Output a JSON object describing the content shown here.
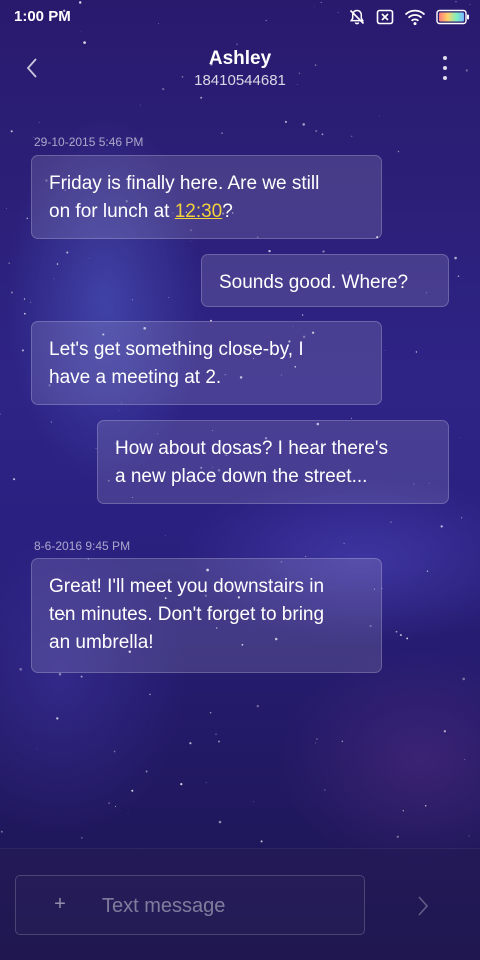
{
  "status_bar": {
    "time": "1:00 PM",
    "icons": [
      "notifications-off-icon",
      "no-sim-icon",
      "wifi-icon",
      "battery-icon"
    ]
  },
  "header": {
    "contact_name": "Ashley",
    "contact_number": "18410544681",
    "back_icon": "chevron-left-icon",
    "menu_icon": "more-vertical-icon"
  },
  "conversation": {
    "timestamp_1": "29-10-2015 5:46 PM",
    "msg_1": {
      "line_1": "Friday is finally here. Are we still",
      "line_2_prefix": "on for lunch at ",
      "link_text": "12:30",
      "line_2_suffix": "?"
    },
    "msg_2": "Sounds good. Where?",
    "msg_3": {
      "line_1": "Let's get something close-by, I",
      "line_2": "have a meeting at 2."
    },
    "msg_4": {
      "line_1": "How about dosas? I hear there's",
      "line_2": "a new place down the street..."
    },
    "timestamp_2": "8-6-2016 9:45 PM",
    "msg_5": {
      "line_1": "Great! I'll meet you downstairs in",
      "line_2": "ten minutes. Don't forget to bring",
      "line_3": "an umbrella!"
    }
  },
  "composer": {
    "attach_label": "+",
    "placeholder": "Text message",
    "value": "",
    "send_icon": "chevron-right-icon"
  },
  "colors": {
    "link": "#f4d23a",
    "background_top": "#2a1a6e",
    "background_bottom": "#1c1550"
  }
}
